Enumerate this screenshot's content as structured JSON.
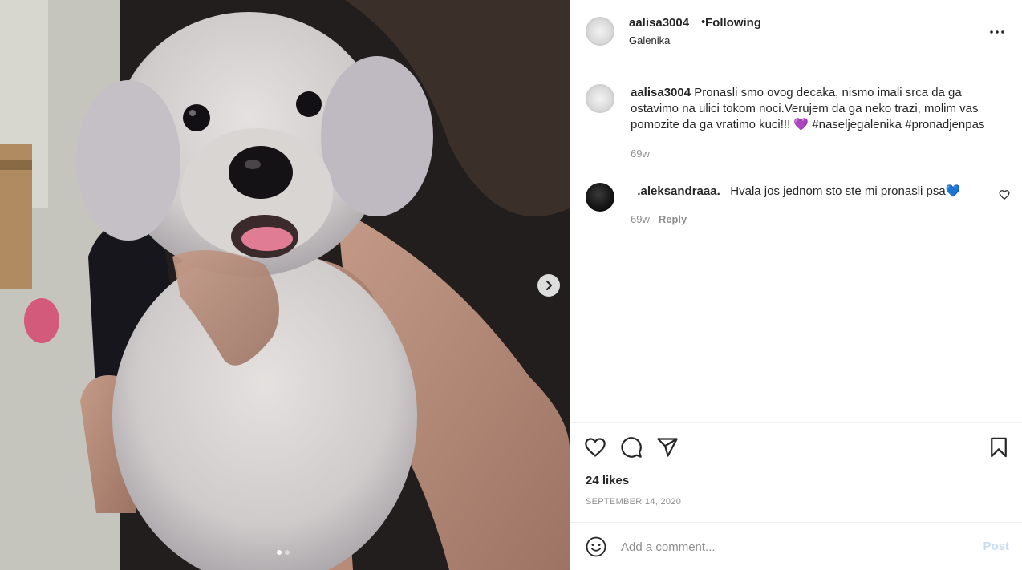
{
  "header": {
    "username": "aalisa3004",
    "separator": "•",
    "follow_status": "Following",
    "location": "Galenika"
  },
  "caption": {
    "username": "aalisa3004",
    "text": "Pronasli smo ovog decaka, nismo imali srca da ga ostavimo na ulici tokom noci.Verujem da ga neko trazi, molim vas pomozite da ga vratimo kuci!!! 💜 #naseljegalenika #pronadjenpas",
    "time": "69w"
  },
  "comments": [
    {
      "username": "_.aleksandraaa._",
      "text": "Hvala jos jednom sto ste mi pronasli psa💙",
      "time": "69w",
      "reply_label": "Reply"
    }
  ],
  "stats": {
    "likes": "24 likes",
    "date": "SEPTEMBER 14, 2020"
  },
  "add_comment": {
    "placeholder": "Add a comment...",
    "post_label": "Post"
  },
  "carousel": {
    "total": 2,
    "current": 1
  },
  "icons": {
    "more": "more-options-icon",
    "next": "chevron-right-icon",
    "like": "heart-icon",
    "comment": "comment-bubble-icon",
    "share": "paper-plane-icon",
    "save": "bookmark-icon",
    "emoji": "smiley-icon"
  },
  "colors": {
    "text": "#262626",
    "secondary": "#8e8e8e",
    "post_button_disabled": "#c7dcf5",
    "divider": "#efefef"
  }
}
